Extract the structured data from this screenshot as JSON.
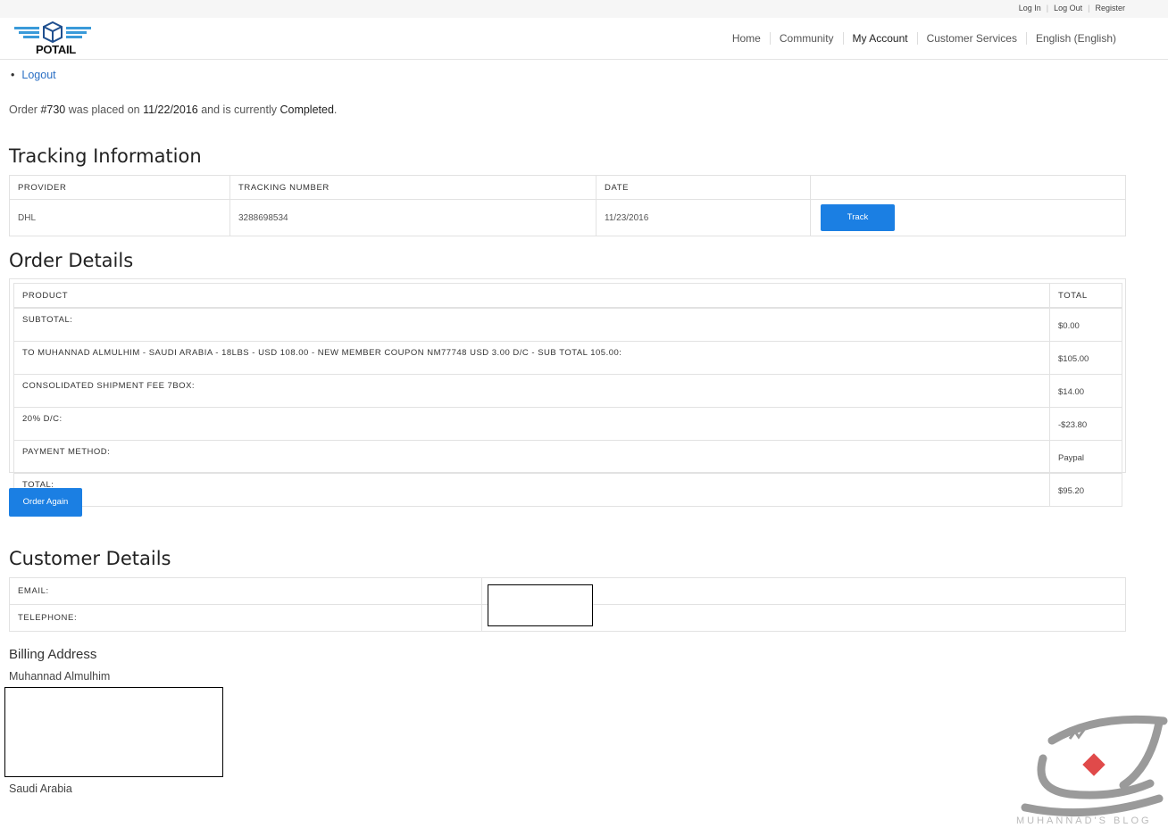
{
  "top_links": {
    "login": "Log In",
    "logout": "Log Out",
    "register": "Register"
  },
  "brand": {
    "name": "POTAIL",
    "color": "#3a9ad9"
  },
  "nav": [
    "Home",
    "Community",
    "My Account",
    "Customer Services",
    "English (English)"
  ],
  "account_menu": {
    "logout": "Logout"
  },
  "order_status": {
    "prefix": "Order ",
    "number": "#730",
    "mid": " was placed on ",
    "date": "11/22/2016",
    "mid2": " and is currently ",
    "status": "Completed",
    "suffix": "."
  },
  "tracking": {
    "title": "Tracking Information",
    "headers": [
      "PROVIDER",
      "TRACKING NUMBER",
      "DATE",
      ""
    ],
    "row": {
      "provider": "DHL",
      "number": "3288698534",
      "date": "11/23/2016",
      "button": "Track"
    }
  },
  "order_details": {
    "title": "Order Details",
    "headers": [
      "PRODUCT",
      "TOTAL"
    ],
    "rows": [
      {
        "label": "SUBTOTAL:",
        "value": "$0.00"
      },
      {
        "label": "TO MUHANNAD ALMULHIM - SAUDI ARABIA - 18LBS - USD 108.00 - NEW MEMBER COUPON NM77748 USD 3.00 D/C - SUB TOTAL 105.00:",
        "value": "$105.00"
      },
      {
        "label": "CONSOLIDATED SHIPMENT FEE 7BOX:",
        "value": "$14.00"
      },
      {
        "label": "20% D/C:",
        "value": "-$23.80"
      },
      {
        "label": "PAYMENT METHOD:",
        "value": "Paypal"
      },
      {
        "label": "TOTAL:",
        "value": "$95.20"
      }
    ],
    "order_again": "Order Again"
  },
  "customer_details": {
    "title": "Customer Details",
    "email_label": "EMAIL:",
    "telephone_label": "TELEPHONE:"
  },
  "billing": {
    "title": "Billing Address",
    "name": "Muhannad Almulhim",
    "country": "Saudi Arabia"
  },
  "watermark": {
    "text": "MUHANNAD'S BLOG"
  },
  "colors": {
    "accent": "#1b7fe3",
    "link": "#2a6fc4"
  }
}
